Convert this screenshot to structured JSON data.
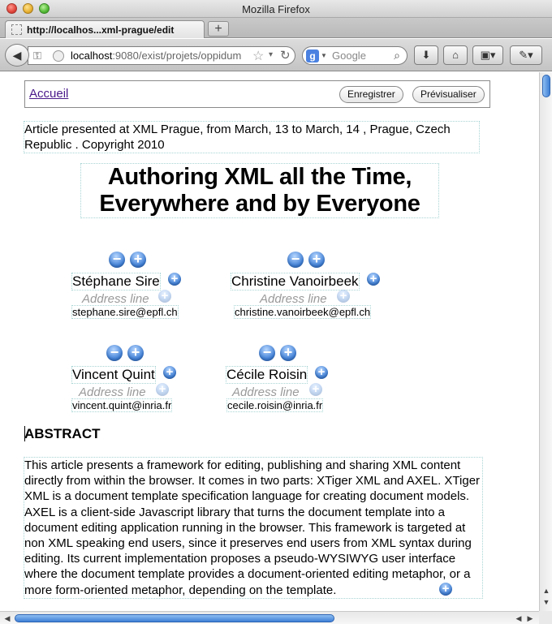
{
  "window": {
    "title": "Mozilla Firefox"
  },
  "tab": {
    "label": "http://localhos...xml-prague/edit",
    "new_tab": "+"
  },
  "nav": {
    "url_host": "localhost",
    "url_rest": ":9080/exist/projets/oppidum",
    "search_placeholder": "Google",
    "search_engine": "g"
  },
  "editor": {
    "home_link": "Accueil",
    "save_button": "Enregistrer",
    "preview_button": "Prévisualiser"
  },
  "article": {
    "conference": "Article presented at XML Prague, from March, 13 to March, 14 , Prague, Czech Republic . Copyright 2010",
    "title": "Authoring XML all the Time, Everywhere and by Everyone",
    "address_placeholder": "Address line",
    "authors": [
      {
        "name": "Stéphane Sire",
        "email": "stephane.sire@epfl.ch"
      },
      {
        "name": "Christine Vanoirbeek",
        "email": "christine.vanoirbeek@epfl.ch"
      },
      {
        "name": "Vincent Quint",
        "email": "vincent.quint@inria.fr"
      },
      {
        "name": "Cécile Roisin",
        "email": "cecile.roisin@inria.fr"
      }
    ],
    "abstract_heading": "ABSTRACT",
    "abstract": "This article presents a framework for editing, publishing and sharing XML content directly from within the browser. It comes in two parts: XTiger XML and AXEL. XTiger XML is a document template specification language for creating document models. AXEL is a client-side Javascript library that turns the document template into a document editing application running in the browser. This framework is targeted at non XML speaking end users, since it preserves end users from XML syntax during editing. Its current implementation proposes a pseudo-WYSIWYG user interface where the document template provides a document-oriented editing metaphor, or a more form-oriented metaphor, depending on the template."
  },
  "icons": {
    "minus": "−",
    "plus": "+"
  }
}
